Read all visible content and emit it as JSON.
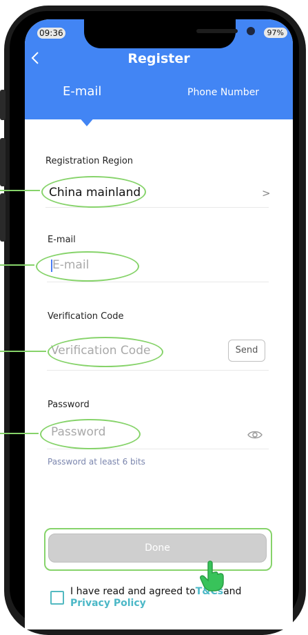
{
  "status": {
    "time": "09:36",
    "right": "97%"
  },
  "header": {
    "back_icon": "chevron-left-icon",
    "title": "Register"
  },
  "tabs": [
    {
      "label": "E-mail",
      "active": true
    },
    {
      "label": "Phone Number",
      "active": false
    }
  ],
  "form": {
    "region": {
      "label": "Registration Region",
      "value": "China mainland",
      "chevron": ">"
    },
    "email": {
      "label": "E-mail",
      "placeholder": "E-mail"
    },
    "verification": {
      "label": "Verification Code",
      "placeholder": "Verification Code",
      "send_label": "Send"
    },
    "password": {
      "label": "Password",
      "placeholder": "Password",
      "hint": "Password at least 6 bits"
    }
  },
  "done_label": "Done",
  "agreement": {
    "prefix": "I have read and agreed to",
    "tc": "T&Cs",
    "mid": "and",
    "privacy": "Privacy Policy"
  },
  "colors": {
    "header": "#4285f4",
    "highlight": "#86d36a",
    "link": "#4cb8c7",
    "hint": "#7b86ae"
  }
}
